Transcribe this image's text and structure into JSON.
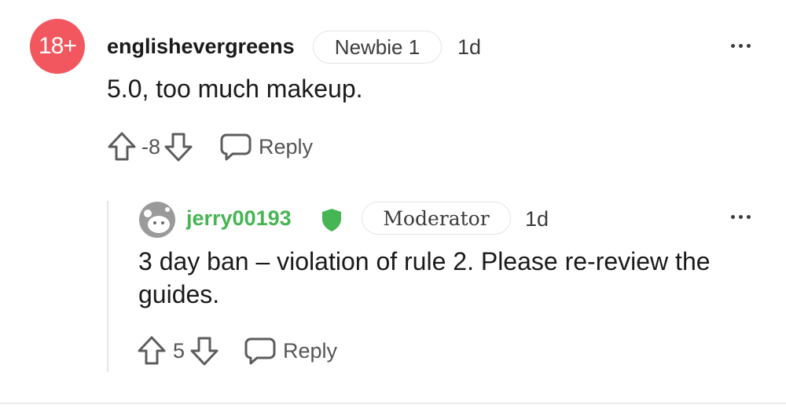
{
  "comment": {
    "avatar_text": "18+",
    "username": "englishevergreens",
    "flair": "Newbie 1",
    "time": "1d",
    "text": "5.0, too much makeup.",
    "score": "-8",
    "reply_label": "Reply"
  },
  "reply": {
    "username": "jerry00193",
    "username_color": "#46b553",
    "flair": "Moderator",
    "time": "1d",
    "text_line1": "3 day ban – violation of rule 2. Please re-review the",
    "text_line2": "guides.",
    "score": "5",
    "reply_label": "Reply"
  },
  "colors": {
    "nsfw_avatar": "#f2575f",
    "mod_shield": "#46b553",
    "icons": "#5c5c5c"
  }
}
